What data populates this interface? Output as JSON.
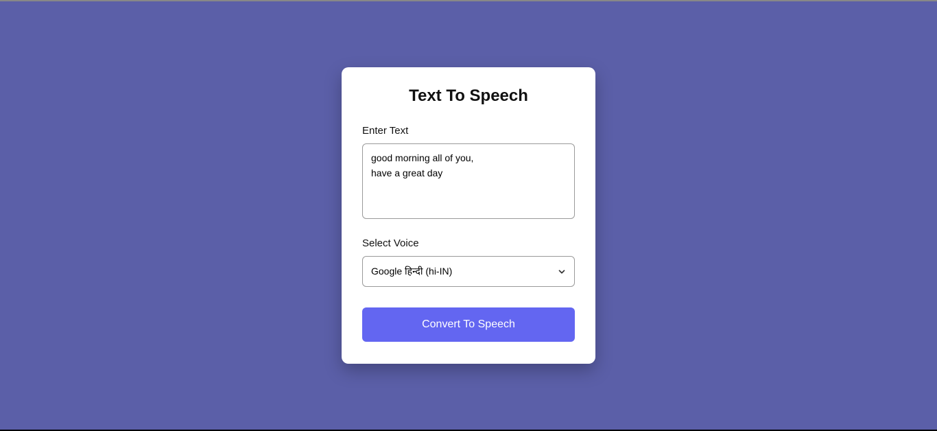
{
  "card": {
    "title": "Text To Speech",
    "enterTextLabel": "Enter Text",
    "textValue": "good morning all of you,\nhave a great day",
    "selectVoiceLabel": "Select Voice",
    "selectedVoice": "Google हिन्दी (hi-IN)",
    "buttonLabel": "Convert To Speech"
  }
}
